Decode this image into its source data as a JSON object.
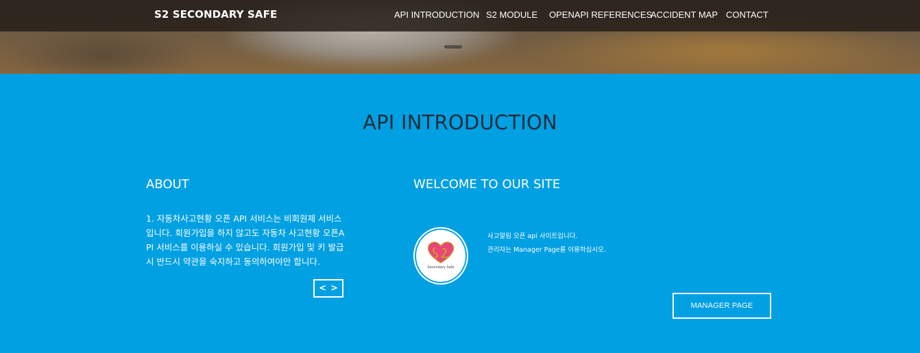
{
  "navbar": {
    "brand": "S2 SECONDARY SAFE",
    "items": [
      {
        "label": "API INTRODUCTION"
      },
      {
        "label": "S2 MODULE"
      },
      {
        "label": "OPENAPI REFERENCES"
      },
      {
        "label": "ACCIDENT MAP"
      },
      {
        "label": "CONTACT"
      }
    ]
  },
  "section": {
    "title": "API INTRODUCTION",
    "background_color": "#00a0e3",
    "about": {
      "heading": "ABOUT",
      "text": "1. 자동차사고현황 오픈 API 서비스는 비회원제 서비스입니다. 회원가입을 하지 않고도 자동차 사고현황 오픈API 서비스를 이용하실 수 있습니다. 회원가입 및 키 발급시 반드시 약관을 숙지하고 동의하여야만 합니다.",
      "carousel_prev_icon": "chevron-left-icon",
      "carousel_next_icon": "chevron-right-icon"
    },
    "welcome": {
      "heading": "WELCOME TO OUR SITE",
      "logo_caption": "Secondary Safe",
      "line1": "사고알림 오픈 api 사이트입니다.",
      "line2": "관리자는 Manager Page를 이용하십시오.",
      "button_label": "MANAGER PAGE"
    }
  }
}
